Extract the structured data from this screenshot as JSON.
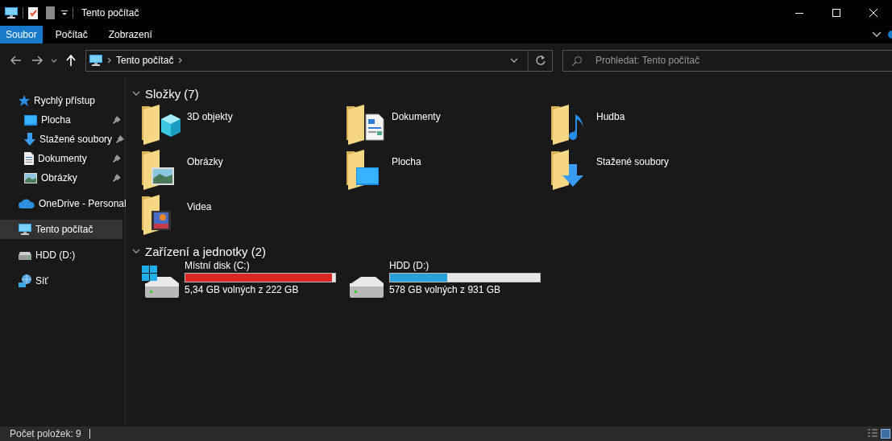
{
  "window": {
    "title": "Tento počítač"
  },
  "ribbon": {
    "tabs": [
      {
        "label": "Soubor",
        "selected": true
      },
      {
        "label": "Počítač",
        "selected": false
      },
      {
        "label": "Zobrazení",
        "selected": false
      }
    ]
  },
  "address_bar": {
    "path": [
      "Tento počítač"
    ]
  },
  "search": {
    "placeholder": "Prohledat: Tento počítač"
  },
  "sidebar": {
    "items": [
      {
        "label": "Rychlý přístup",
        "kind": "star",
        "selected": false,
        "children": [
          {
            "label": "Plocha",
            "kind": "desktop",
            "pinned": true,
            "selected": false
          },
          {
            "label": "Stažené soubory",
            "kind": "downloads",
            "pinned": true,
            "selected": false
          },
          {
            "label": "Dokumenty",
            "kind": "documents",
            "pinned": true,
            "selected": false
          },
          {
            "label": "Obrázky",
            "kind": "pictures",
            "pinned": true,
            "selected": false
          }
        ]
      },
      {
        "label": "OneDrive - Personal",
        "kind": "cloud",
        "selected": false
      },
      {
        "label": "Tento počítač",
        "kind": "pc",
        "selected": true
      },
      {
        "label": "HDD (D:)",
        "kind": "drive",
        "selected": false
      },
      {
        "label": "Síť",
        "kind": "network",
        "selected": false
      }
    ]
  },
  "sections": [
    {
      "title": "Složky (7)",
      "kind": "folders",
      "expanded": true,
      "items": [
        {
          "name": "3D objekty",
          "kind": "objects"
        },
        {
          "name": "Dokumenty",
          "kind": "documents"
        },
        {
          "name": "Hudba",
          "kind": "music"
        },
        {
          "name": "Obrázky",
          "kind": "pictures"
        },
        {
          "name": "Plocha",
          "kind": "desktop"
        },
        {
          "name": "Stažené soubory",
          "kind": "downloads"
        },
        {
          "name": "Videa",
          "kind": "videos"
        }
      ]
    },
    {
      "title": "Zařízení a jednotky (2)",
      "kind": "drives",
      "expanded": true,
      "items": [
        {
          "name": "Místní disk (C:)",
          "kind": "system",
          "level": 0.976,
          "color": "#da2626",
          "free": "5,34 GB volných z 222 GB"
        },
        {
          "name": "HDD (D:)",
          "kind": "data",
          "level": 0.38,
          "color": "#26a0da",
          "free": "578 GB volných z 931 GB"
        }
      ]
    }
  ],
  "status_bar": {
    "item_count": "Počet položek: 9"
  }
}
